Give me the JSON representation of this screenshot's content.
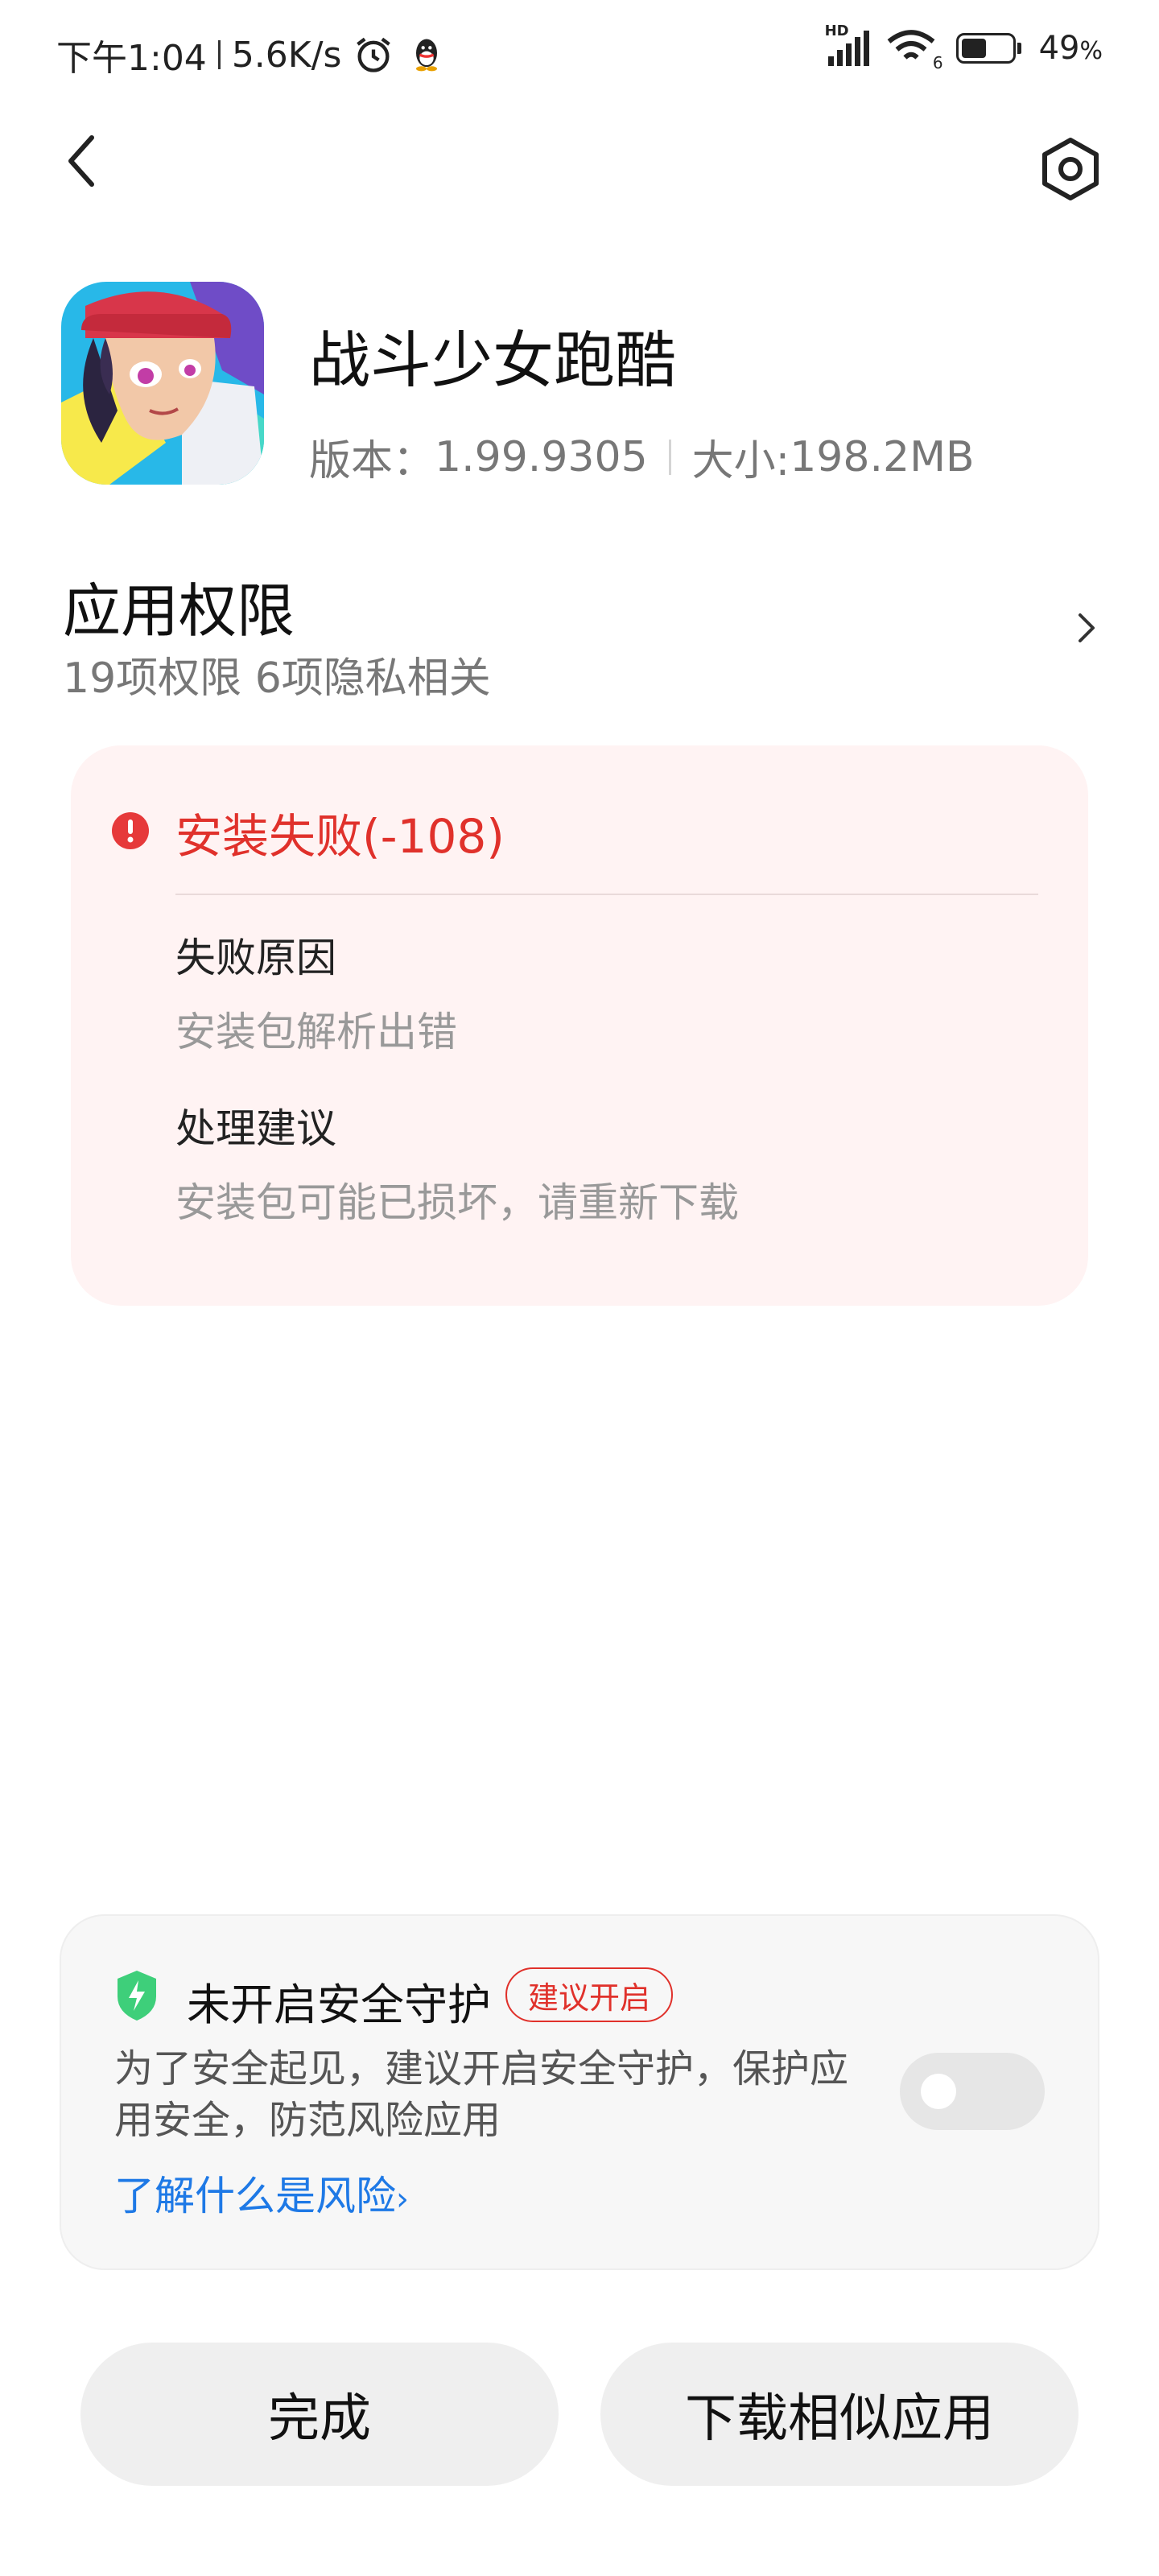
{
  "status_bar": {
    "time": "下午1:04",
    "speed": "5.6K/s",
    "battery": "49",
    "battery_unit": "%",
    "network": "HD",
    "wifi_label": "6"
  },
  "nav": {
    "back_icon": "chevron-left-icon",
    "settings_icon": "settings-hexagon-icon"
  },
  "app": {
    "name": "战斗少女跑酷",
    "version_label": "版本：",
    "version": "1.99.9305",
    "size_label": "大小:",
    "size": "198.2MB"
  },
  "permissions": {
    "title": "应用权限",
    "subtitle": "19项权限 6项隐私相关"
  },
  "error": {
    "title": "安装失败(-108)",
    "reason_heading": "失败原因",
    "reason_text": "安装包解析出错",
    "advice_heading": "处理建议",
    "advice_text": "安装包可能已损坏，请重新下载",
    "color": "#e0312b"
  },
  "security": {
    "title": "未开启安全守护",
    "badge": "建议开启",
    "description": "为了安全起见，建议开启安全守护，保护应用安全，防范风险应用",
    "link": "了解什么是风险",
    "toggle_on": false,
    "link_color": "#1e79e6",
    "shield_color": "#3ecf7a"
  },
  "buttons": {
    "done": "完成",
    "similar": "下载相似应用"
  }
}
